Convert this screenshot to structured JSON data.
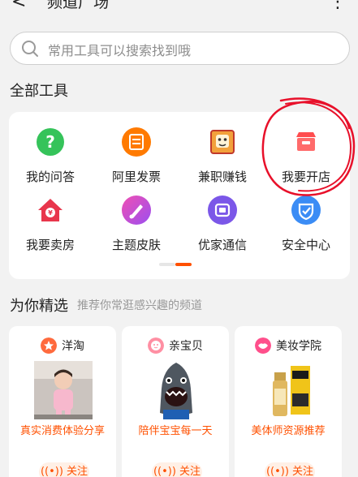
{
  "header": {
    "back_glyph": "<",
    "title": "频道广场",
    "more_glyph": "⋮"
  },
  "search": {
    "placeholder": "常用工具可以搜索找到哦"
  },
  "tools_section": {
    "title": "全部工具",
    "items": [
      {
        "label": "我的问答",
        "icon": "question-icon",
        "color": "#35c35a"
      },
      {
        "label": "阿里发票",
        "icon": "invoice-icon",
        "color": "#ff7a00"
      },
      {
        "label": "兼职赚钱",
        "icon": "tiger-icon",
        "color": "#f2a13b"
      },
      {
        "label": "我要开店",
        "icon": "shop-icon",
        "color": "#ff4d4f"
      },
      {
        "label": "我要卖房",
        "icon": "house-icon",
        "color": "#e8364c"
      },
      {
        "label": "主题皮肤",
        "icon": "theme-icon",
        "color": "#c64fe0"
      },
      {
        "label": "优家通信",
        "icon": "phone-icon",
        "color": "#7b57e8"
      },
      {
        "label": "安全中心",
        "icon": "shield-icon",
        "color": "#3b8cf5"
      }
    ],
    "page_indicator": {
      "pages": 2,
      "active": 2
    }
  },
  "recommend": {
    "title": "为你精选",
    "subtitle": "推荐你常逛感兴趣的频道",
    "cards": [
      {
        "name": "洋淘",
        "desc": "真实消费体验分享",
        "follow": "关注",
        "avatar_icon": "star-badge-icon"
      },
      {
        "name": "亲宝贝",
        "desc": "陪伴宝宝每一天",
        "follow": "关注",
        "avatar_icon": "baby-icon"
      },
      {
        "name": "美妆学院",
        "desc": "美体师资源推荐",
        "follow": "关注",
        "avatar_icon": "lips-icon"
      }
    ]
  },
  "colors": {
    "accent": "#ff5000",
    "annotation": "#e8102a"
  }
}
